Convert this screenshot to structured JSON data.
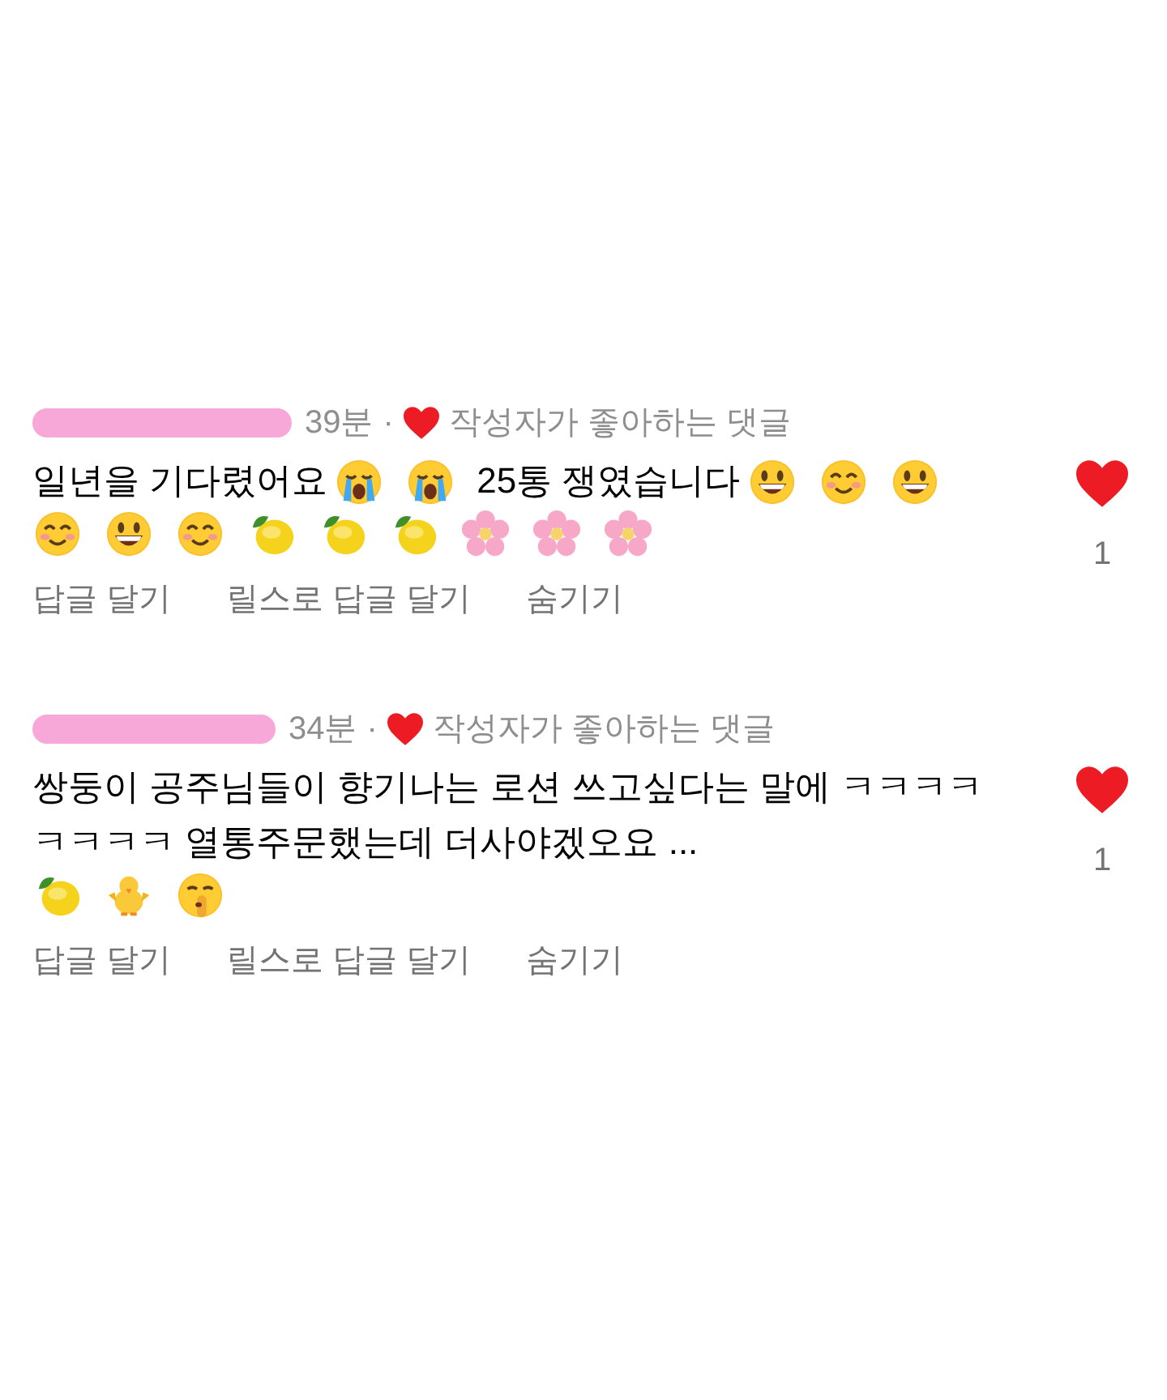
{
  "comments": [
    {
      "time": "39분",
      "separator": "·",
      "author_liked": true,
      "author_liked_label": "작성자가 좋아하는 댓글",
      "liked": true,
      "like_count": "1",
      "body": [
        {
          "kind": "text",
          "text": "일년을 기다렸어요"
        },
        {
          "kind": "crying"
        },
        {
          "kind": "crying"
        },
        {
          "kind": "text",
          "text": "25통 쟁였습니다"
        },
        {
          "kind": "grin"
        },
        {
          "kind": "blush"
        },
        {
          "kind": "grin"
        },
        {
          "kind": "blush"
        },
        {
          "kind": "grin"
        },
        {
          "kind": "blush"
        },
        {
          "kind": "lemon"
        },
        {
          "kind": "lemon"
        },
        {
          "kind": "lemon"
        },
        {
          "kind": "blossom"
        },
        {
          "kind": "blossom"
        },
        {
          "kind": "blossom"
        }
      ],
      "actions": [
        "답글 달기",
        "릴스로 답글 달기",
        "숨기기"
      ]
    },
    {
      "time": "34분",
      "separator": "·",
      "author_liked": true,
      "author_liked_label": "작성자가 좋아하는 댓글",
      "liked": true,
      "like_count": "1",
      "body": [
        {
          "kind": "text",
          "text": "쌍둥이 공주님들이 향기나는 로션 쓰고싶다는 말에 ㅋㅋㅋㅋㅋㅋㅋㅋ 열통주문했는데 더사야겠오요 ..."
        },
        {
          "kind": "lemon"
        },
        {
          "kind": "chick"
        },
        {
          "kind": "shush"
        }
      ],
      "actions": [
        "답글 달기",
        "릴스로 답글 달기",
        "숨기기"
      ]
    }
  ]
}
